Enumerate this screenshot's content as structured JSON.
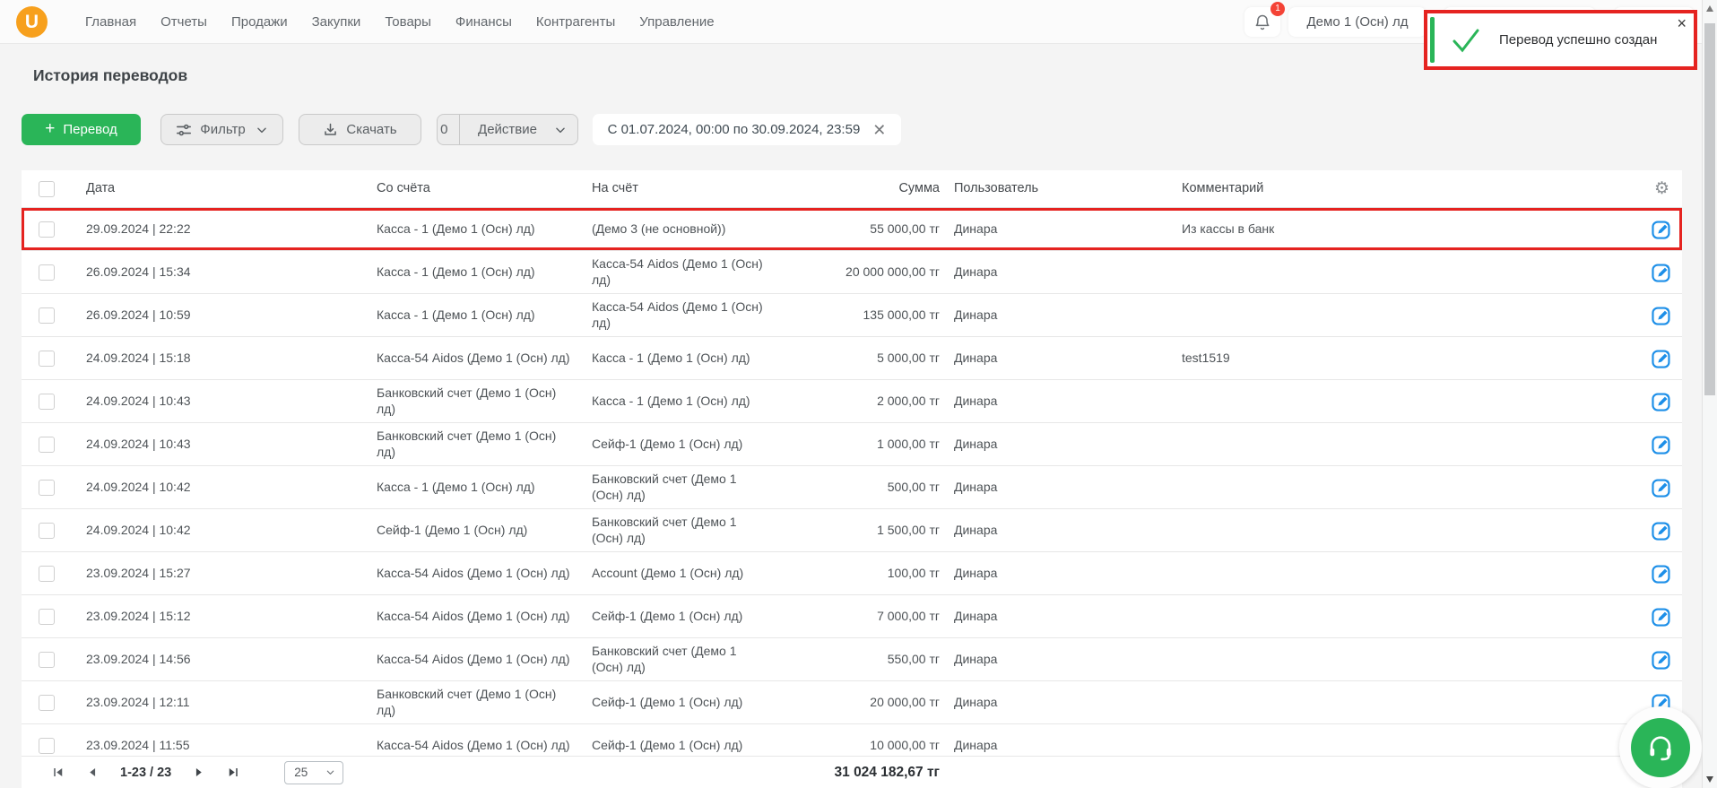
{
  "colors": {
    "green": "#2ab558",
    "red": "#e52320",
    "blue": "#1d8fe8",
    "orange": "#f7a01d"
  },
  "topnav": {
    "logo_letter": "U",
    "items": [
      "Главная",
      "Отчеты",
      "Продажи",
      "Закупки",
      "Товары",
      "Финансы",
      "Контрагенты",
      "Управление"
    ],
    "notification_count": "1",
    "company_selector": "Демо 1 (Осн) лд"
  },
  "toast": {
    "message": "Перевод успешно создан",
    "close": "×"
  },
  "page": {
    "title": "История переводов"
  },
  "toolbar": {
    "new_transfer": "Перевод",
    "filter": "Фильтр",
    "download": "Скачать",
    "action_count": "0",
    "action": "Действие",
    "date_range": "С 01.07.2024, 00:00 по 30.09.2024, 23:59"
  },
  "table": {
    "columns": {
      "date": "Дата",
      "from": "Со счёта",
      "to": "На счёт",
      "amount": "Сумма",
      "user": "Пользователь",
      "comment": "Комментарий"
    },
    "rows": [
      {
        "date": "29.09.2024 | 22:22",
        "from": "Касса - 1 (Демо 1 (Осн) лд)",
        "to": "(Демо 3 (не основной))",
        "amount": "55 000,00 тг",
        "user": "Динара",
        "comment": "Из кассы в банк",
        "highlighted": true
      },
      {
        "date": "26.09.2024 | 15:34",
        "from": "Касса - 1 (Демо 1 (Осн) лд)",
        "to": "Касса-54 Aidos (Демо 1 (Осн) лд)",
        "amount": "20 000 000,00 тг",
        "user": "Динара",
        "comment": "",
        "highlighted": false
      },
      {
        "date": "26.09.2024 | 10:59",
        "from": "Касса - 1 (Демо 1 (Осн) лд)",
        "to": "Касса-54 Aidos (Демо 1 (Осн) лд)",
        "amount": "135 000,00 тг",
        "user": "Динара",
        "comment": "",
        "highlighted": false
      },
      {
        "date": "24.09.2024 | 15:18",
        "from": "Касса-54 Aidos (Демо 1 (Осн) лд)",
        "to": "Касса - 1 (Демо 1 (Осн) лд)",
        "amount": "5 000,00 тг",
        "user": "Динара",
        "comment": "test1519",
        "highlighted": false
      },
      {
        "date": "24.09.2024 | 10:43",
        "from": "Банковский счет (Демо 1 (Осн) лд)",
        "to": "Касса - 1 (Демо 1 (Осн) лд)",
        "amount": "2 000,00 тг",
        "user": "Динара",
        "comment": "",
        "highlighted": false
      },
      {
        "date": "24.09.2024 | 10:43",
        "from": "Банковский счет (Демо 1 (Осн) лд)",
        "to": "Сейф-1 (Демо 1 (Осн) лд)",
        "amount": "1 000,00 тг",
        "user": "Динара",
        "comment": "",
        "highlighted": false
      },
      {
        "date": "24.09.2024 | 10:42",
        "from": "Касса - 1 (Демо 1 (Осн) лд)",
        "to": "Банковский счет (Демо 1 (Осн) лд)",
        "amount": "500,00 тг",
        "user": "Динара",
        "comment": "",
        "highlighted": false
      },
      {
        "date": "24.09.2024 | 10:42",
        "from": "Сейф-1 (Демо 1 (Осн) лд)",
        "to": "Банковский счет (Демо 1 (Осн) лд)",
        "amount": "1 500,00 тг",
        "user": "Динара",
        "comment": "",
        "highlighted": false
      },
      {
        "date": "23.09.2024 | 15:27",
        "from": "Касса-54 Aidos (Демо 1 (Осн) лд)",
        "to": "Account (Демо 1 (Осн) лд)",
        "amount": "100,00 тг",
        "user": "Динара",
        "comment": "",
        "highlighted": false
      },
      {
        "date": "23.09.2024 | 15:12",
        "from": "Касса-54 Aidos (Демо 1 (Осн) лд)",
        "to": "Сейф-1 (Демо 1 (Осн) лд)",
        "amount": "7 000,00 тг",
        "user": "Динара",
        "comment": "",
        "highlighted": false
      },
      {
        "date": "23.09.2024 | 14:56",
        "from": "Касса-54 Aidos (Демо 1 (Осн) лд)",
        "to": "Банковский счет (Демо 1 (Осн) лд)",
        "amount": "550,00 тг",
        "user": "Динара",
        "comment": "",
        "highlighted": false
      },
      {
        "date": "23.09.2024 | 12:11",
        "from": "Банковский счет (Демо 1 (Осн) лд)",
        "to": "Сейф-1 (Демо 1 (Осн) лд)",
        "amount": "20 000,00 тг",
        "user": "Динара",
        "comment": "",
        "highlighted": false
      },
      {
        "date": "23.09.2024 | 11:55",
        "from": "Касса-54 Aidos (Демо 1 (Осн) лд)",
        "to": "Сейф-1 (Демо 1 (Осн) лд)",
        "amount": "10 000,00 тг",
        "user": "Динара",
        "comment": "",
        "highlighted": false
      }
    ]
  },
  "pagination": {
    "range": "1-23 / 23",
    "page_size": "25",
    "total": "31 024 182,67 тг"
  }
}
